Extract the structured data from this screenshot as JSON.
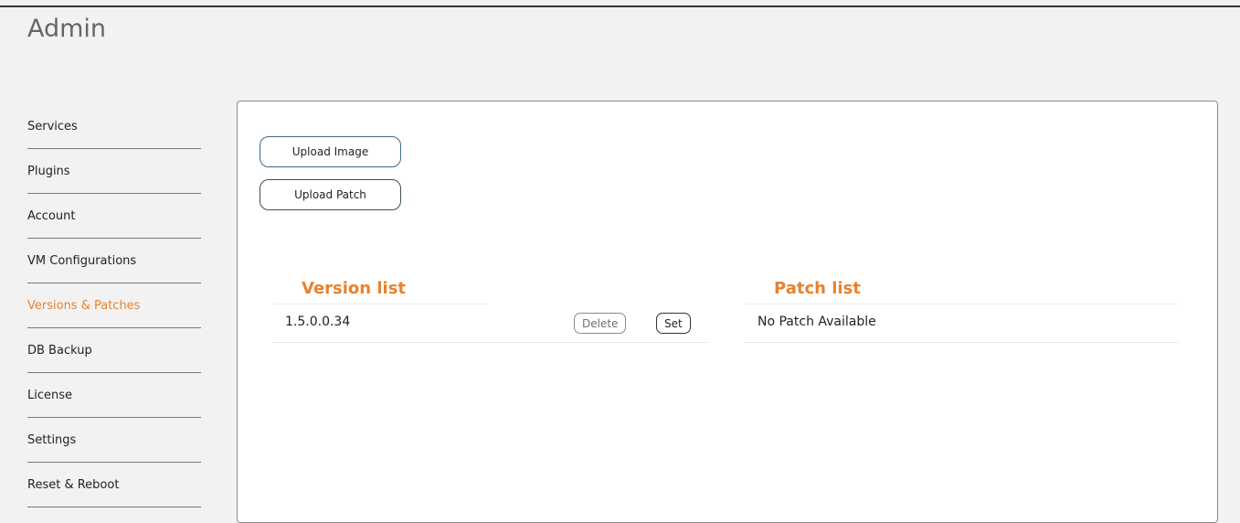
{
  "page": {
    "title": "Admin"
  },
  "sidebar": {
    "items": [
      {
        "label": "Services"
      },
      {
        "label": "Plugins"
      },
      {
        "label": "Account"
      },
      {
        "label": "VM Configurations"
      },
      {
        "label": "Versions & Patches",
        "active": true
      },
      {
        "label": "DB Backup"
      },
      {
        "label": "License"
      },
      {
        "label": "Settings"
      },
      {
        "label": "Reset & Reboot"
      }
    ]
  },
  "actions": {
    "upload_image_label": "Upload Image",
    "upload_patch_label": "Upload Patch"
  },
  "version_list": {
    "heading": "Version list",
    "rows": [
      {
        "version": "1.5.0.0.34",
        "delete_label": "Delete",
        "set_label": "Set"
      }
    ]
  },
  "patch_list": {
    "heading": "Patch list",
    "empty_text": "No Patch Available"
  },
  "colors": {
    "accent": "#e8822f",
    "panel_background": "#ffffff",
    "page_background": "#f2f2f2"
  }
}
